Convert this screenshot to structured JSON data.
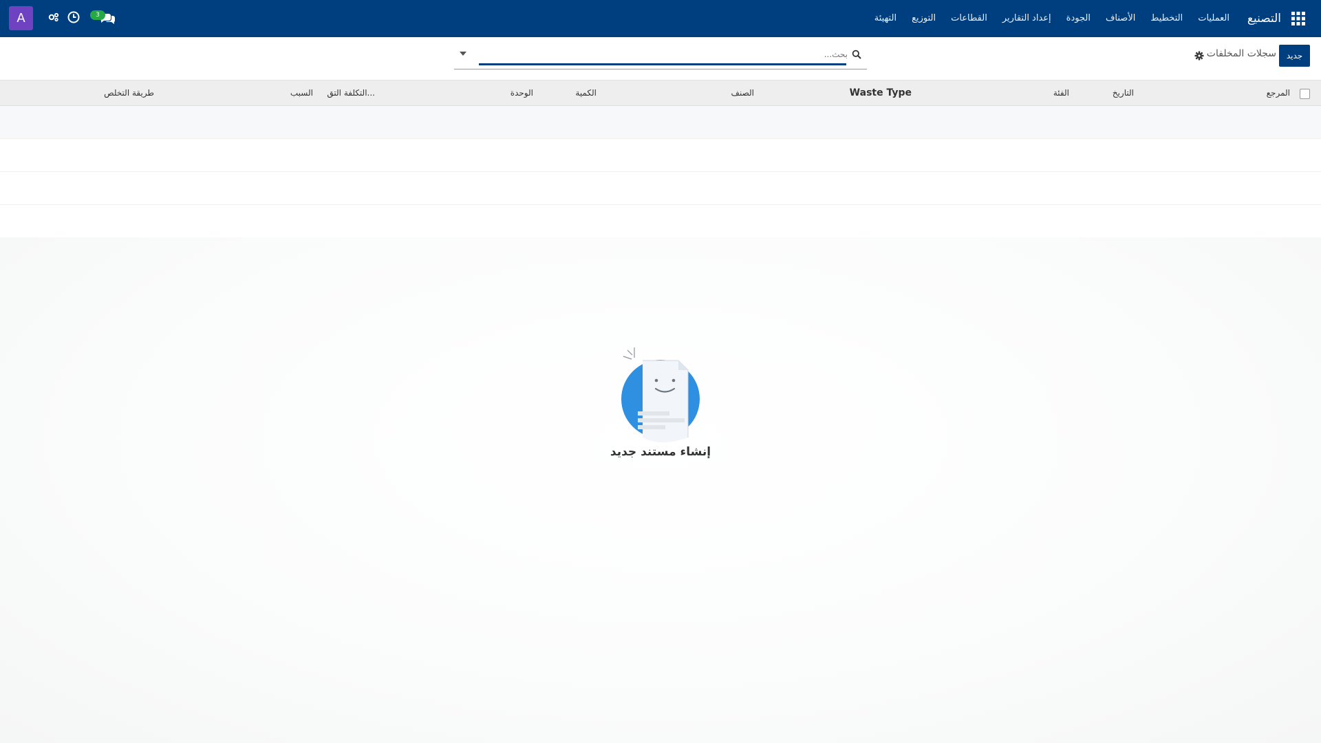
{
  "navbar": {
    "avatar_letter": "A",
    "chat_badge_count": "3",
    "brand": "التصنيع",
    "menu": [
      "العمليات",
      "التخطيط",
      "الأصناف",
      "الجودة",
      "إعداد التقارير",
      "القطاعات",
      "التوزيع",
      "التهيئة"
    ],
    "icons": [
      "apps-grid-icon",
      "chat-icon",
      "activity-clock-icon",
      "debug-icon"
    ],
    "color": "#003f7f"
  },
  "control": {
    "new_button": "جديد",
    "breadcrumb": "سجلات المخلفات",
    "search_placeholder": "بحث..."
  },
  "list": {
    "columns": [
      "المرجع",
      "التاريخ",
      "الفئة",
      "Waste Type",
      "الصنف",
      "الكمية",
      "الوحدة",
      "التكلفة التق...",
      "السبب",
      "طريقة التخلص"
    ]
  },
  "empty_state": {
    "title": "إنشاء مستند جديد"
  },
  "colors": {
    "accent": "#003f7f",
    "avatar": "#6f42c1",
    "badge": "#28a745",
    "illustration": "#2f8fe0"
  }
}
